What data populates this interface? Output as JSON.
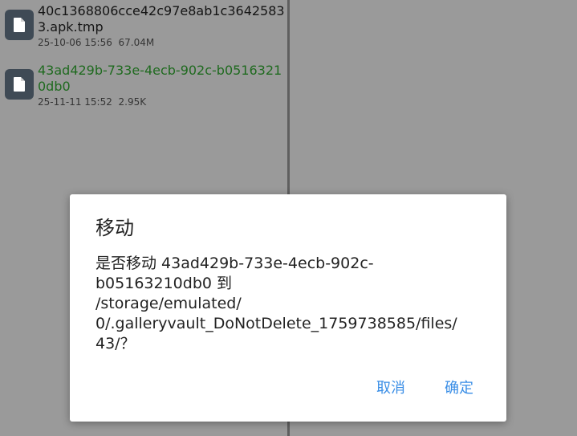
{
  "files": [
    {
      "name": "40c1368806cce42c97e8ab1c36425833.apk.tmp",
      "date": "25-10-06 15:56",
      "size": "67.04M",
      "icon": "file-icon"
    },
    {
      "name": "43ad429b-733e-4ecb-902c-b05163210db0",
      "date": "25-11-11 15:52",
      "size": "2.95K",
      "icon": "file-icon",
      "highlight_color": "#1f6a1f"
    }
  ],
  "dialog": {
    "title": "移动",
    "message_lines": [
      "是否移动 43ad429b-733e-4ecb-902c-",
      "b05163210db0 到",
      "/storage/emulated/",
      "0/.galleryvault_DoNotDelete_1759738585/files/",
      "43/？"
    ],
    "cancel_label": "取消",
    "confirm_label": "确定",
    "accent_color": "#3a8ee6"
  }
}
